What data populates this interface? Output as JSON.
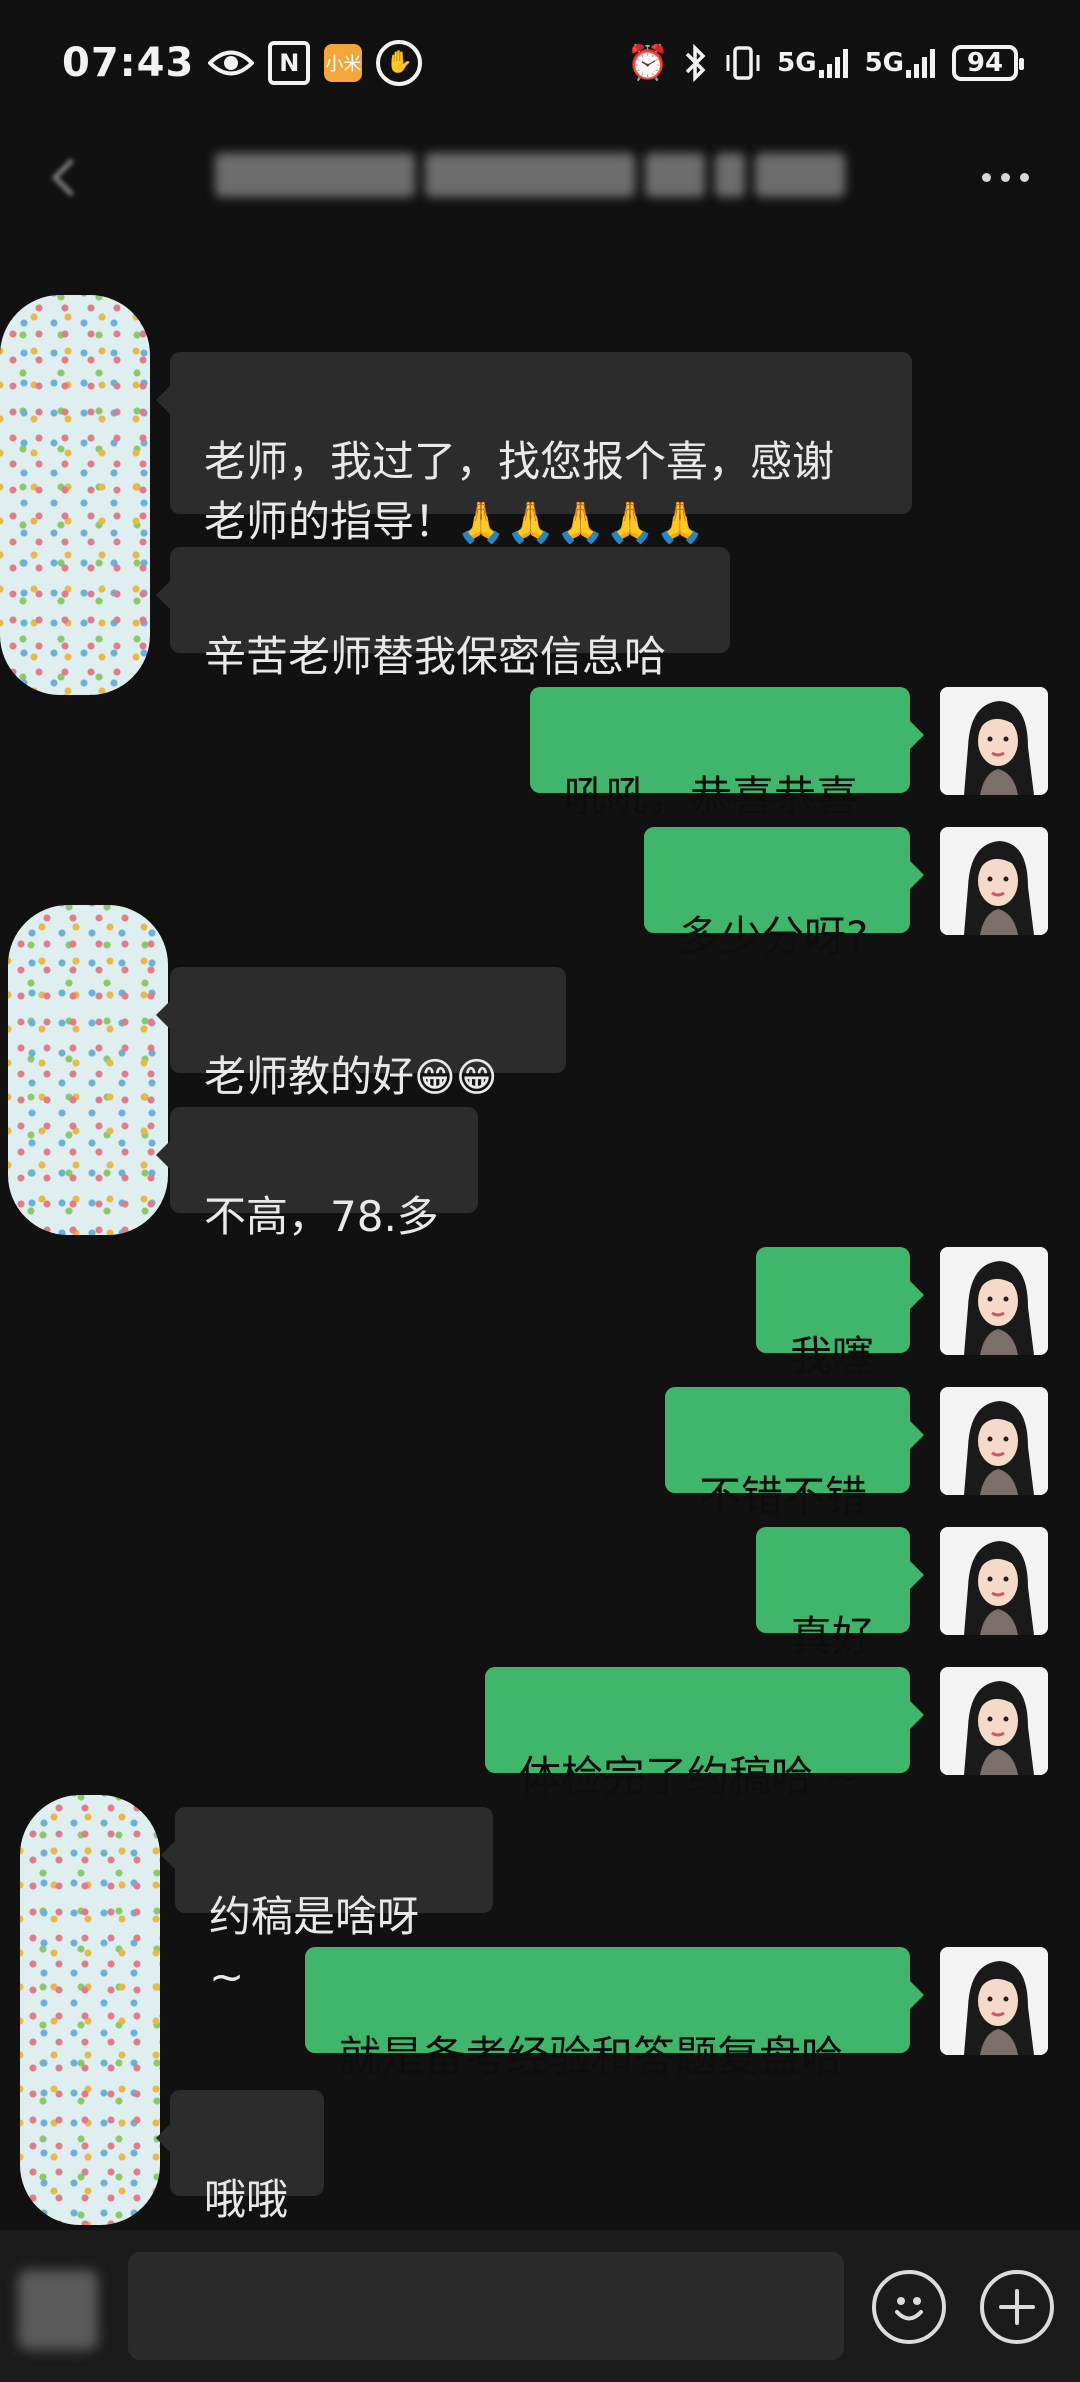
{
  "status_bar": {
    "time": "07:43",
    "battery": "94",
    "signal1": "5G",
    "signal2": "5G",
    "app_badge": "小米",
    "nfc": "N"
  },
  "messages": [
    {
      "id": "m1",
      "dir": "in",
      "text": "老师，我过了，找您报个喜，感谢\n老师的指导！",
      "emoji": "🙏🙏🙏🙏🙏"
    },
    {
      "id": "m2",
      "dir": "in",
      "text": "辛苦老师替我保密信息哈"
    },
    {
      "id": "m3",
      "dir": "out",
      "text": "吼吼，恭喜恭喜"
    },
    {
      "id": "m4",
      "dir": "out",
      "text": "多少分呀?"
    },
    {
      "id": "m5",
      "dir": "in",
      "text": "老师教的好",
      "emoji": "😁😁"
    },
    {
      "id": "m6",
      "dir": "in",
      "text": "不高，78.多"
    },
    {
      "id": "m7",
      "dir": "out",
      "text": "我噻"
    },
    {
      "id": "m8",
      "dir": "out",
      "text": "不错不错"
    },
    {
      "id": "m9",
      "dir": "out",
      "text": "真好"
    },
    {
      "id": "m10",
      "dir": "out",
      "text": "体检完了约稿哈 ~"
    },
    {
      "id": "m11",
      "dir": "in",
      "text": "约稿是啥呀 ~"
    },
    {
      "id": "m12",
      "dir": "out",
      "text": "就是备考经验和答题复盘哈"
    },
    {
      "id": "m13",
      "dir": "in",
      "text": "哦哦"
    }
  ],
  "input_bar": {
    "emoji_icon": "smiley-icon",
    "plus_icon": "plus-icon",
    "plus_label": "+"
  },
  "colors": {
    "background": "#111111",
    "incoming_bubble": "#2c2c2c",
    "outgoing_bubble": "#3fb66b"
  }
}
